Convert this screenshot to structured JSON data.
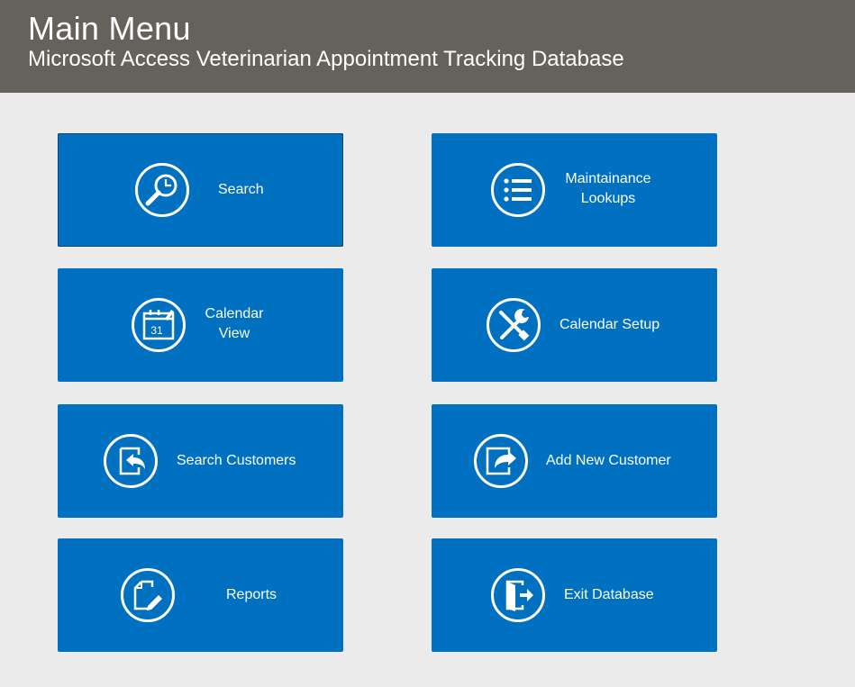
{
  "header": {
    "title": "Main Menu",
    "subtitle": "Microsoft Access Veterinarian Appointment Tracking Database"
  },
  "colors": {
    "header_bg": "#65615b",
    "tile_bg": "#0070c0",
    "page_bg": "#ebebeb"
  },
  "buttons": {
    "search": {
      "label": "Search",
      "icon": "search-clock-icon"
    },
    "maintenance": {
      "label": "Maintainance\nLookups",
      "icon": "list-icon"
    },
    "calendar_view": {
      "label": "Calendar\nView",
      "icon": "calendar-icon",
      "icon_text": "31"
    },
    "calendar_setup": {
      "label": "Calendar Setup",
      "icon": "tools-icon"
    },
    "search_customers": {
      "label": "Search Customers",
      "icon": "return-arrow-icon"
    },
    "add_customer": {
      "label": "Add New Customer",
      "icon": "share-arrow-icon"
    },
    "reports": {
      "label": "Reports",
      "icon": "document-edit-icon"
    },
    "exit": {
      "label": "Exit Database",
      "icon": "exit-door-icon"
    }
  }
}
